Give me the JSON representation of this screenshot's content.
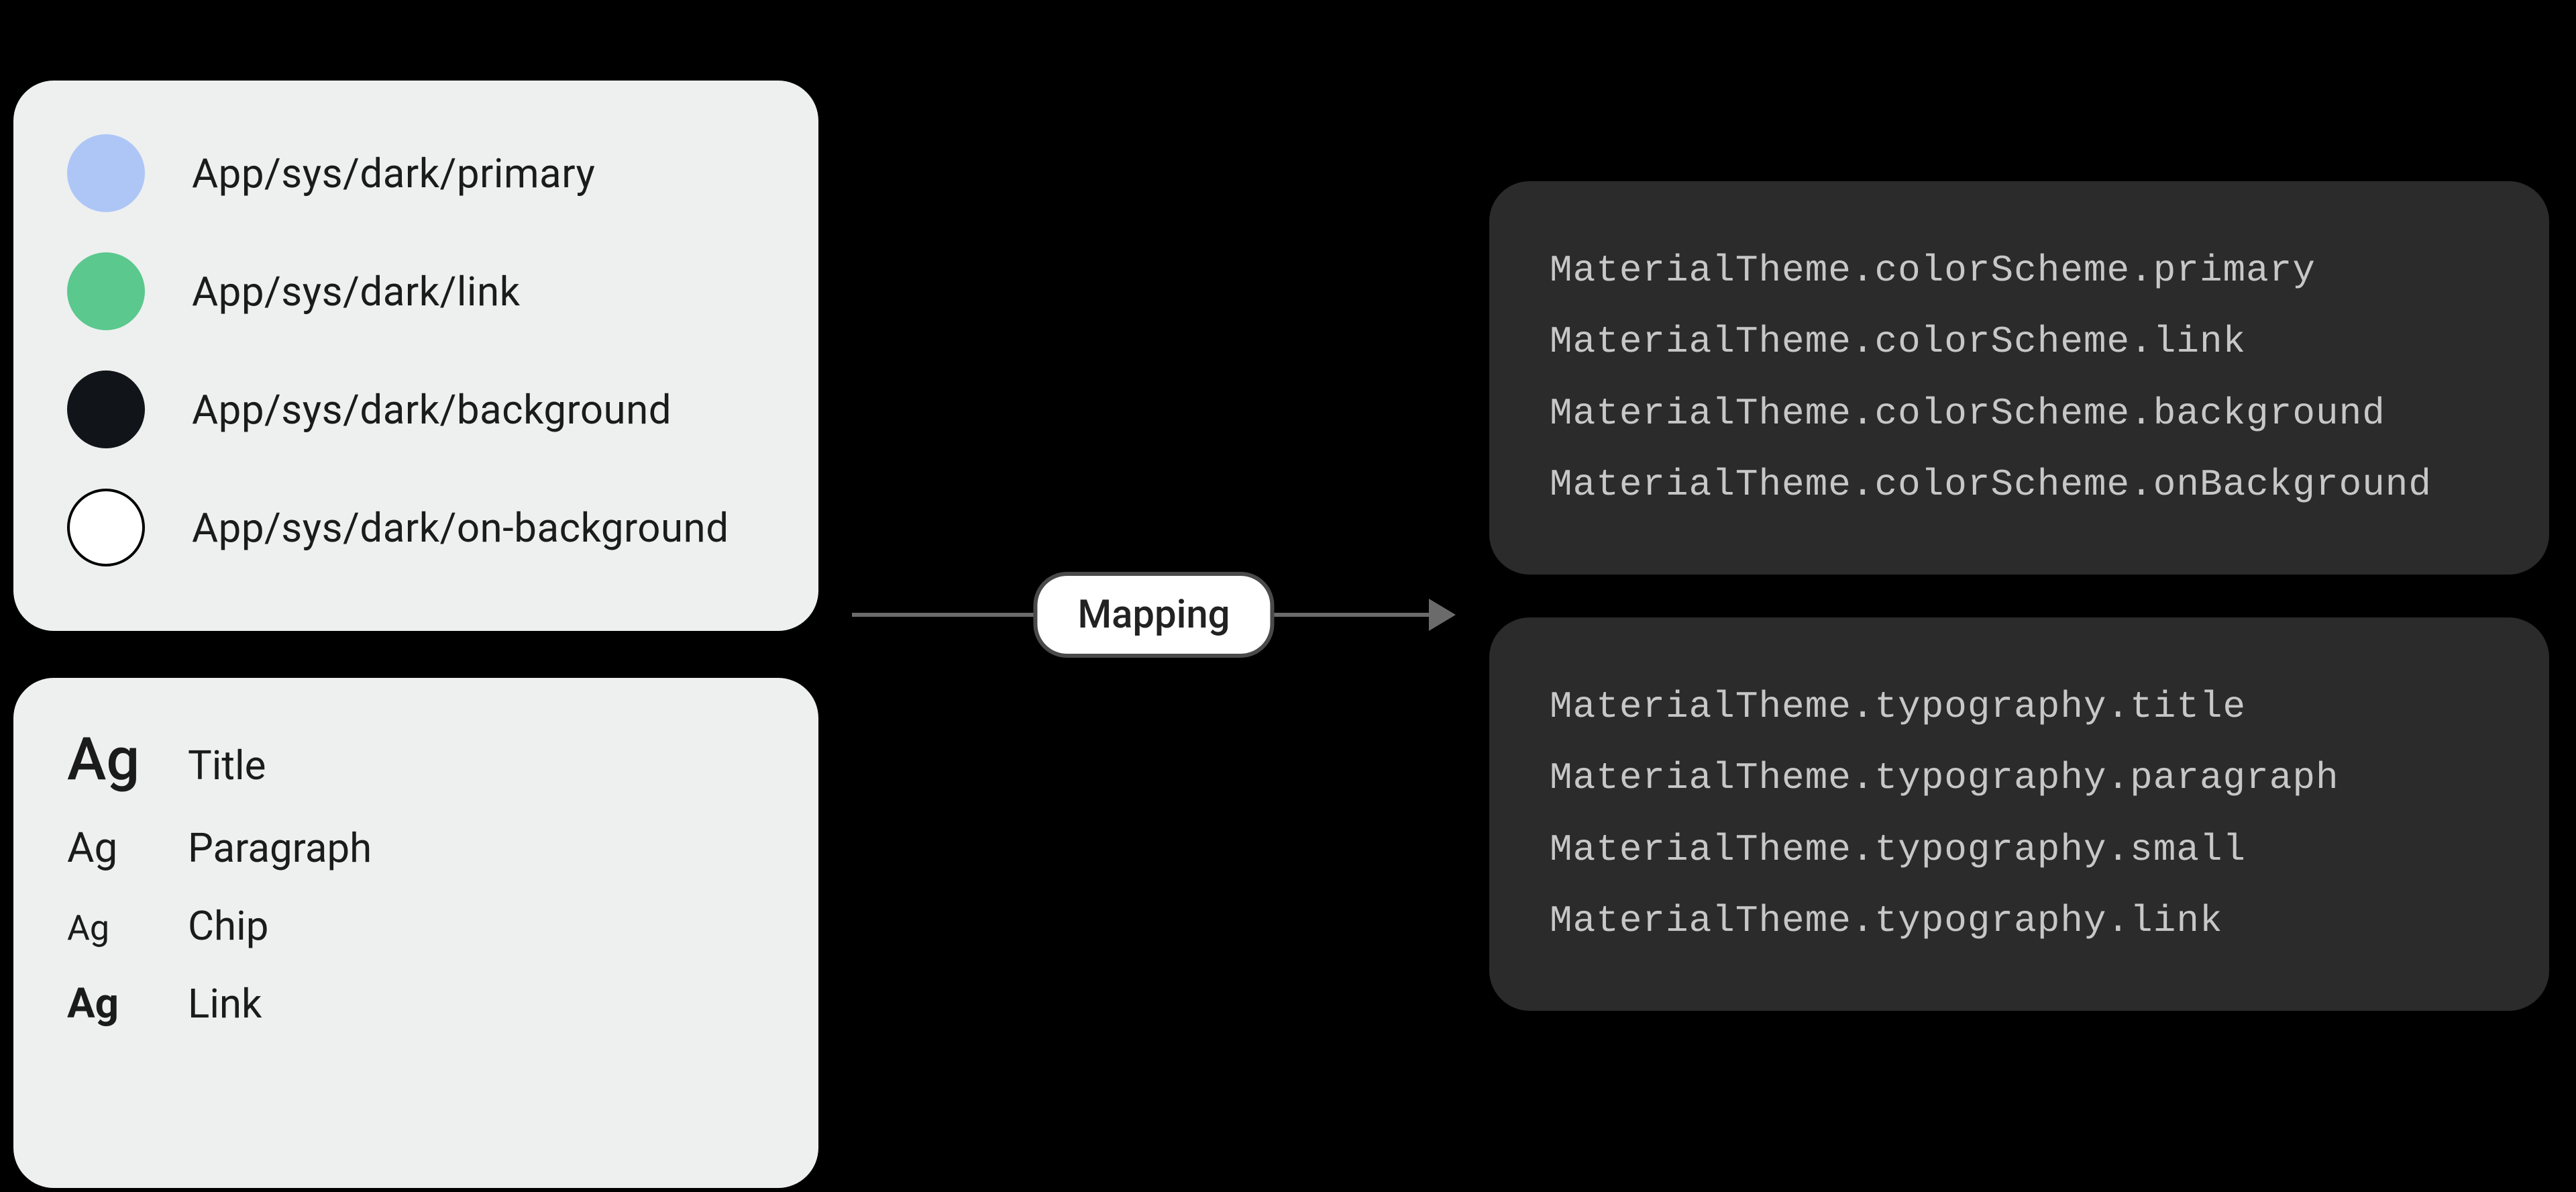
{
  "colors": {
    "items": [
      {
        "label": "App/sys/dark/primary",
        "swatchClass": "primary",
        "hex": "#AEC6F6"
      },
      {
        "label": "App/sys/dark/link",
        "swatchClass": "link",
        "hex": "#5BC88E"
      },
      {
        "label": "App/sys/dark/background",
        "swatchClass": "bg",
        "hex": "#111418"
      },
      {
        "label": "App/sys/dark/on-background",
        "swatchClass": "onbg",
        "hex": "#FFFFFF"
      }
    ]
  },
  "typography": {
    "sample": "Ag",
    "items": [
      {
        "label": "Title",
        "agClass": "title"
      },
      {
        "label": "Paragraph",
        "agClass": "para"
      },
      {
        "label": "Chip",
        "agClass": "chip"
      },
      {
        "label": "Link",
        "agClass": "lnk"
      }
    ]
  },
  "mapping": {
    "pill_label": "Mapping"
  },
  "code": {
    "color_lines": [
      "MaterialTheme.colorScheme.primary",
      "MaterialTheme.colorScheme.link",
      "MaterialTheme.colorScheme.background",
      "MaterialTheme.colorScheme.onBackground"
    ],
    "typo_lines": [
      "MaterialTheme.typography.title",
      "MaterialTheme.typography.paragraph",
      "MaterialTheme.typography.small",
      "MaterialTheme.typography.link"
    ]
  }
}
